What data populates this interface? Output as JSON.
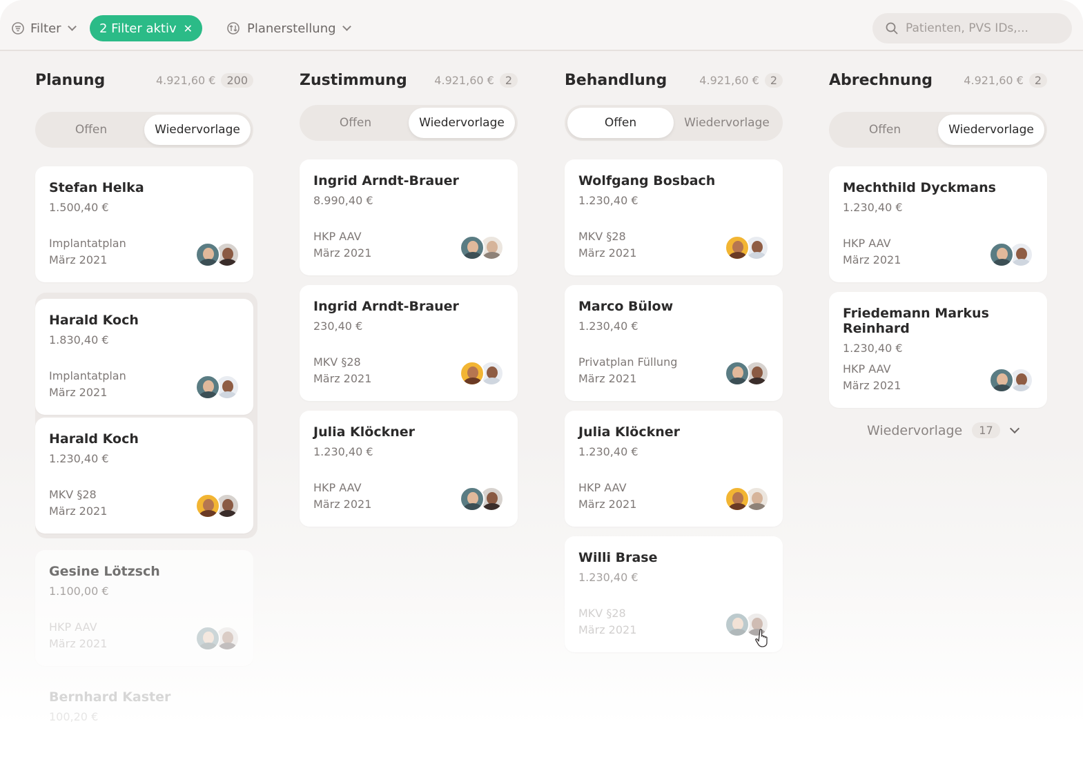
{
  "toolbar": {
    "filter_label": "Filter",
    "active_filters_label": "2 Filter aktiv",
    "view_label": "Planerstellung",
    "search_placeholder": "Patienten, PVS IDs,..."
  },
  "segment_labels": {
    "open": "Offen",
    "followup": "Wiedervorlage"
  },
  "columns": [
    {
      "title": "Planung",
      "sum": "4.921,60 €",
      "count": "200",
      "active_segment": "followup",
      "cards": [
        {
          "name": "Stefan Helka",
          "amount": "1.500,40 €",
          "plan": "Implantatplan",
          "date": "März 2021",
          "avatars": [
            "teal",
            "dark"
          ]
        },
        {
          "name": "Harald Koch",
          "amount": "1.830,40 €",
          "plan": "Implantatplan",
          "date": "März 2021",
          "avatars": [
            "teal",
            "light"
          ]
        },
        {
          "name": "Harald Koch",
          "amount": "1.230,40 €",
          "plan": "MKV §28",
          "date": "März 2021",
          "avatars": [
            "yellow",
            "dark"
          ]
        },
        {
          "name": "Gesine Lötzsch",
          "amount": "1.100,00 €",
          "plan": "HKP AAV",
          "date": "März 2021",
          "avatars": [
            "teal",
            "dark"
          ]
        },
        {
          "name": "Bernhard Kaster",
          "amount": "100,20 €",
          "plan": "",
          "date": "",
          "avatars": []
        }
      ]
    },
    {
      "title": "Zustimmung",
      "sum": "4.921,60 €",
      "count": "2",
      "active_segment": "followup",
      "cards": [
        {
          "name": "Ingrid Arndt-Brauer",
          "amount": "8.990,40 €",
          "plan": "HKP AAV",
          "date": "März 2021",
          "avatars": [
            "teal",
            "beige"
          ]
        },
        {
          "name": "Ingrid Arndt-Brauer",
          "amount": "230,40 €",
          "plan": "MKV §28",
          "date": "März 2021",
          "avatars": [
            "yellow",
            "light"
          ]
        },
        {
          "name": "Julia Klöckner",
          "amount": "1.230,40 €",
          "plan": "HKP AAV",
          "date": "März 2021",
          "avatars": [
            "teal",
            "dark"
          ]
        }
      ]
    },
    {
      "title": "Behandlung",
      "sum": "4.921,60 €",
      "count": "2",
      "active_segment": "open",
      "cards": [
        {
          "name": "Wolfgang Bosbach",
          "amount": "1.230,40 €",
          "plan": "MKV §28",
          "date": "März 2021",
          "avatars": [
            "yellow",
            "light"
          ]
        },
        {
          "name": "Marco Bülow",
          "amount": "1.230,40 €",
          "plan": "Privatplan Füllung",
          "date": "März 2021",
          "avatars": [
            "teal",
            "dark"
          ]
        },
        {
          "name": "Julia Klöckner",
          "amount": "1.230,40 €",
          "plan": "HKP AAV",
          "date": "März 2021",
          "avatars": [
            "yellow",
            "beige"
          ]
        },
        {
          "name": "Willi Brase",
          "amount": "1.230,40 €",
          "plan": "MKV §28",
          "date": "März 2021",
          "avatars": [
            "teal",
            "dark"
          ]
        }
      ]
    },
    {
      "title": "Abrechnung",
      "sum": "4.921,60 €",
      "count": "2",
      "active_segment": "followup",
      "cards": [
        {
          "name": "Mechthild Dyckmans",
          "amount": "1.230,40 €",
          "plan": "HKP AAV",
          "date": "März 2021",
          "avatars": [
            "teal",
            "light"
          ]
        },
        {
          "name": "Friedemann Markus Reinhard",
          "amount": "1.230,40 €",
          "plan": "HKP AAV",
          "date": "März 2021",
          "avatars": [
            "teal",
            "light"
          ]
        }
      ],
      "more_label": "Wiedervorlage",
      "more_count": "17"
    }
  ],
  "colors": {
    "accent": "#2bbb87",
    "background": "#f4f2f1",
    "card": "#ffffff"
  }
}
